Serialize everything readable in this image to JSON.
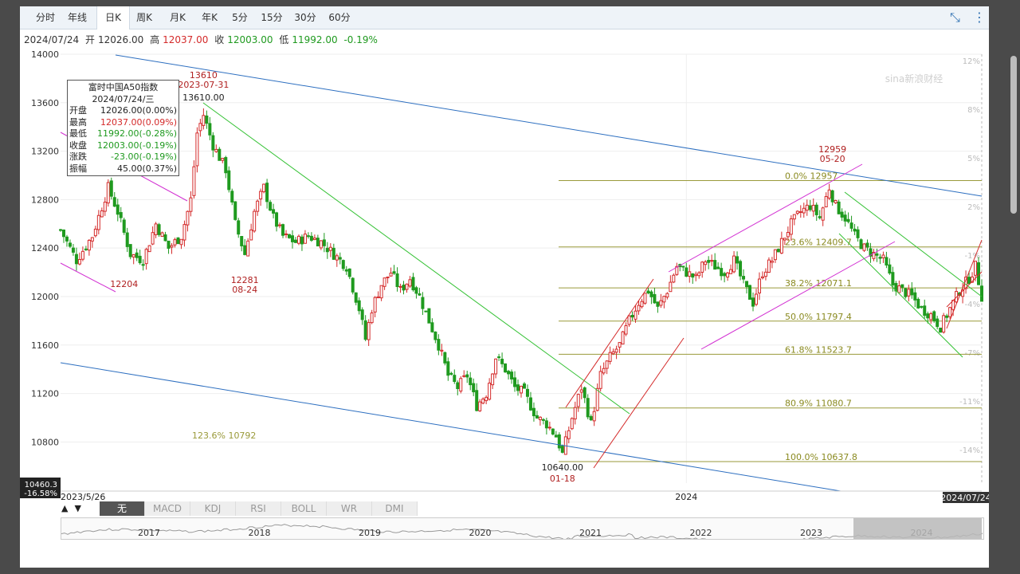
{
  "tabs": [
    "分时",
    "年线",
    "日K",
    "周K",
    "月K",
    "年K",
    "5分",
    "15分",
    "30分",
    "60分"
  ],
  "active_tab": "日K",
  "ohlc_bar": {
    "date": "2024/07/24",
    "open_label": "开",
    "open": "12026.00",
    "high_label": "高",
    "high": "12037.00",
    "close_label": "收",
    "close": "12003.00",
    "low_label": "低",
    "low": "11992.00",
    "change": "-0.19%"
  },
  "tooltip": {
    "title": "富时中国A50指数",
    "date": "2024/07/24/三",
    "rows": [
      {
        "label": "开盘",
        "value": "12026.00(0.00%)",
        "color": "#222"
      },
      {
        "label": "最高",
        "value": "12037.00(0.09%)",
        "color": "#d42a2a"
      },
      {
        "label": "最低",
        "value": "11992.00(-0.28%)",
        "color": "#1f9a1f"
      },
      {
        "label": "收盘",
        "value": "12003.00(-0.19%)",
        "color": "#1f9a1f"
      },
      {
        "label": "涨跌",
        "value": "-23.00(-0.19%)",
        "color": "#1f9a1f"
      },
      {
        "label": "振幅",
        "value": "45.00(0.37%)",
        "color": "#222"
      }
    ]
  },
  "left_price_labels": {
    "bottom_price": "10460.3",
    "bottom_pct": "-16.58%"
  },
  "x_axis": {
    "start": "2023/5/26",
    "mid": "2024",
    "end": "2024/07/24"
  },
  "indicators": [
    "无",
    "MACD",
    "KDJ",
    "RSI",
    "BOLL",
    "WR",
    "DMI"
  ],
  "active_indicator": "无",
  "nav_years": [
    "2017",
    "2018",
    "2019",
    "2020",
    "2021",
    "2022",
    "2023",
    "2024"
  ],
  "watermark": "sina新浪财经",
  "colors": {
    "up": "#d42a2a",
    "down": "#1f9a1f",
    "trend_blue": "#2d6fc0",
    "trend_green": "#33c133",
    "trend_red": "#d42a2a",
    "trend_magenta": "#d230d2",
    "fib": "#9a9a3a"
  },
  "chart_data": {
    "type": "candlestick",
    "title": "富时中国A50指数",
    "y_ticks": [
      14000,
      13600,
      13200,
      12800,
      12400,
      12000,
      11600,
      11200,
      10800
    ],
    "y_range": [
      10460.3,
      14000
    ],
    "pct_ticks": [
      "12%",
      "8%",
      "5%",
      "2%",
      "-1%",
      "-4%",
      "-7%",
      "-11%",
      "-14%",
      "-17%"
    ],
    "annotations": [
      {
        "text": "13610",
        "sub": "2023-07-31",
        "x_index": 45,
        "y": 13610
      },
      {
        "text": "13610.00",
        "x_index": 45,
        "y": 13610
      },
      {
        "text": "12204",
        "x_index": 20,
        "y": 12204
      },
      {
        "text": "12281",
        "sub": "08-24",
        "x_index": 58,
        "y": 12281
      },
      {
        "text": "10640.00",
        "sub": "01-18",
        "x_index": 158,
        "y": 10640
      },
      {
        "text": "12959",
        "sub": "05-20",
        "x_index": 243,
        "y": 12959
      }
    ],
    "fibonacci": [
      {
        "label": "0.0% 12957",
        "value": 12957
      },
      {
        "label": "23.6% 12409.7",
        "value": 12409.7
      },
      {
        "label": "38.2% 12071.1",
        "value": 12071.1
      },
      {
        "label": "50.0% 11797.4",
        "value": 11797.4
      },
      {
        "label": "61.8% 11523.7",
        "value": 11523.7
      },
      {
        "label": "80.9% 11080.7",
        "value": 11080.7
      },
      {
        "label": "100.0% 10637.8",
        "value": 10637.8
      },
      {
        "label": "123.6% 10792",
        "value": 10792
      }
    ],
    "close_path": [
      [
        0,
        12550
      ],
      [
        5,
        12300
      ],
      [
        10,
        12500
      ],
      [
        15,
        12900
      ],
      [
        18,
        12700
      ],
      [
        22,
        12350
      ],
      [
        26,
        12300
      ],
      [
        30,
        12600
      ],
      [
        34,
        12400
      ],
      [
        38,
        12500
      ],
      [
        41,
        12800
      ],
      [
        43,
        13350
      ],
      [
        45,
        13500
      ],
      [
        48,
        13250
      ],
      [
        52,
        13050
      ],
      [
        55,
        12600
      ],
      [
        58,
        12350
      ],
      [
        61,
        12700
      ],
      [
        64,
        12900
      ],
      [
        67,
        12650
      ],
      [
        70,
        12500
      ],
      [
        74,
        12450
      ],
      [
        78,
        12500
      ],
      [
        82,
        12450
      ],
      [
        86,
        12350
      ],
      [
        90,
        12250
      ],
      [
        94,
        11900
      ],
      [
        96,
        11650
      ],
      [
        98,
        11900
      ],
      [
        101,
        12100
      ],
      [
        104,
        12200
      ],
      [
        107,
        12050
      ],
      [
        110,
        12150
      ],
      [
        113,
        12000
      ],
      [
        116,
        11800
      ],
      [
        119,
        11600
      ],
      [
        122,
        11350
      ],
      [
        125,
        11250
      ],
      [
        128,
        11350
      ],
      [
        131,
        11100
      ],
      [
        134,
        11200
      ],
      [
        137,
        11500
      ],
      [
        140,
        11400
      ],
      [
        143,
        11250
      ],
      [
        146,
        11200
      ],
      [
        150,
        11000
      ],
      [
        153,
        10950
      ],
      [
        156,
        10850
      ],
      [
        158,
        10700
      ],
      [
        161,
        11000
      ],
      [
        164,
        11250
      ],
      [
        167,
        10950
      ],
      [
        170,
        11350
      ],
      [
        173,
        11500
      ],
      [
        176,
        11600
      ],
      [
        179,
        11800
      ],
      [
        182,
        11950
      ],
      [
        185,
        12050
      ],
      [
        188,
        11900
      ],
      [
        191,
        12050
      ],
      [
        194,
        12250
      ],
      [
        197,
        12200
      ],
      [
        200,
        12150
      ],
      [
        203,
        12300
      ],
      [
        206,
        12250
      ],
      [
        209,
        12200
      ],
      [
        212,
        12300
      ],
      [
        215,
        12100
      ],
      [
        218,
        11950
      ],
      [
        221,
        12200
      ],
      [
        224,
        12300
      ],
      [
        227,
        12450
      ],
      [
        230,
        12600
      ],
      [
        233,
        12700
      ],
      [
        236,
        12750
      ],
      [
        239,
        12650
      ],
      [
        242,
        12900
      ],
      [
        244,
        12750
      ],
      [
        247,
        12650
      ],
      [
        250,
        12500
      ],
      [
        253,
        12400
      ],
      [
        256,
        12350
      ],
      [
        259,
        12300
      ],
      [
        262,
        12100
      ],
      [
        265,
        12050
      ],
      [
        268,
        12000
      ],
      [
        271,
        11900
      ],
      [
        274,
        11850
      ],
      [
        277,
        11750
      ],
      [
        280,
        11900
      ],
      [
        283,
        12050
      ],
      [
        286,
        12150
      ],
      [
        288,
        12250
      ],
      [
        290,
        12003
      ]
    ]
  }
}
